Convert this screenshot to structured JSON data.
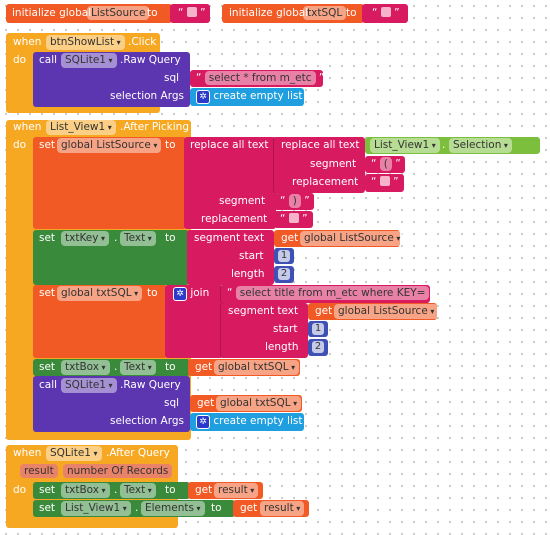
{
  "globals": [
    {
      "keyword": "initialize global",
      "name": "ListSource",
      "to": "to",
      "value": ""
    },
    {
      "keyword": "initialize global",
      "name": "txtSQL",
      "to": "to",
      "value": ""
    }
  ],
  "event1": {
    "when": "when",
    "component": "btnShowList",
    "event": ".Click",
    "do": "do",
    "call": "call",
    "callComp": "SQLite1",
    "method": ".Raw Query",
    "sql": "sql",
    "sqlValue": "select * from m_etc",
    "args": "selection Args",
    "list": "create empty list"
  },
  "event2": {
    "when": "when",
    "component": "List_View1",
    "event": ".After Picking",
    "do": "do",
    "set1": {
      "set": "set",
      "var": "global ListSource",
      "to": "to",
      "replace": "replace all text",
      "segment": "segment",
      "replacement": "replacement",
      "comp": "List_View1",
      "dot": ".",
      "prop": "Selection",
      "seg1": "(",
      "seg2": ")"
    },
    "set2": {
      "set": "set",
      "comp": "txtKey",
      "dot": ".",
      "prop": "Text",
      "to": "to",
      "segment": "segment  text",
      "get": "get",
      "var": "global ListSource",
      "start": "start",
      "length": "length",
      "startVal": "1",
      "lengthVal": "2"
    },
    "set3": {
      "set": "set",
      "var": "global txtSQL",
      "to": "to",
      "join": "join",
      "str": "select title from m_etc where KEY=",
      "segment": "segment  text",
      "get": "get",
      "getVar": "global ListSource",
      "start": "start",
      "length": "length",
      "startVal": "1",
      "lengthVal": "2"
    },
    "set4": {
      "set": "set",
      "comp": "txtBox",
      "dot": ".",
      "prop": "Text",
      "to": "to",
      "get": "get",
      "var": "global txtSQL"
    },
    "call": {
      "call": "call",
      "comp": "SQLite1",
      "method": ".Raw Query",
      "sql": "sql",
      "get": "get",
      "var": "global txtSQL",
      "args": "selection Args",
      "list": "create empty list"
    }
  },
  "event3": {
    "when": "when",
    "component": "SQLite1",
    "event": ".After Query",
    "params": [
      "result",
      "number Of Records"
    ],
    "do": "do",
    "set1": {
      "set": "set",
      "comp": "txtBox",
      "dot": ".",
      "prop": "Text",
      "to": "to",
      "get": "get",
      "var": "result"
    },
    "set2": {
      "set": "set",
      "comp": "List_View1",
      "dot": ".",
      "prop": "Elements",
      "to": "to",
      "get": "get",
      "var": "result"
    }
  }
}
